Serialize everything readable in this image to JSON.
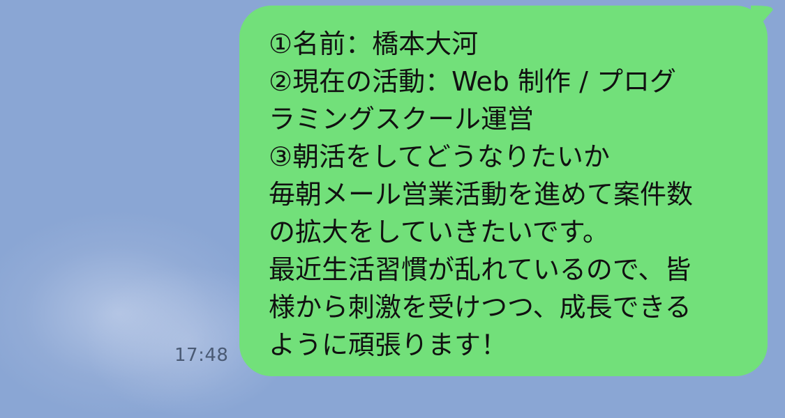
{
  "chat": {
    "timestamp": "17:48",
    "bubble_color": "#72e07a",
    "background_color": "#8aa6d4",
    "message_lines": [
      "①名前：橋本大河",
      "②現在の活動：Web 制作 / プログ",
      "ラミングスクール運営",
      "③朝活をしてどうなりたいか",
      "毎朝メール営業活動を進めて案件数",
      "の拡大をしていきたいです。",
      "最近生活習慣が乱れているので、皆",
      "様から刺激を受けつつ、成長できる",
      "ように頑張ります！"
    ]
  }
}
